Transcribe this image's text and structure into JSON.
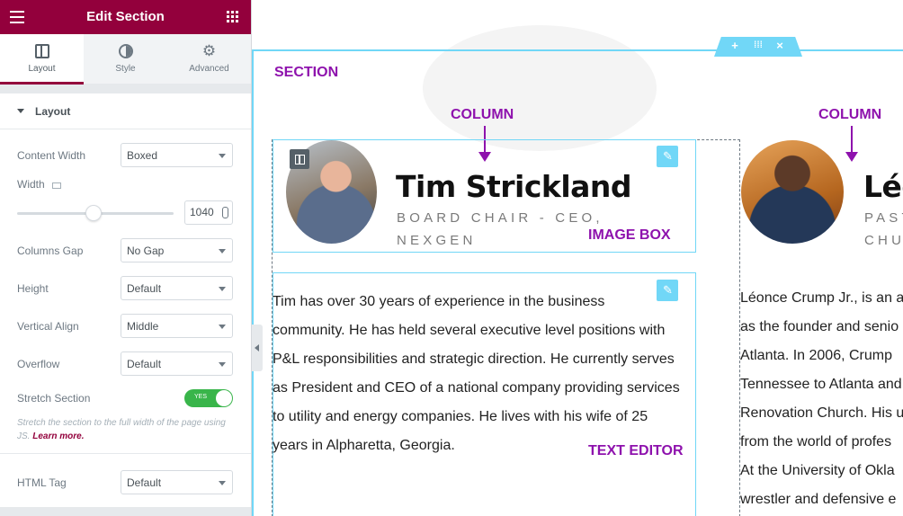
{
  "panel": {
    "title": "Edit Section",
    "tabs": [
      {
        "label": "Layout",
        "icon": "layout-icon"
      },
      {
        "label": "Style",
        "icon": "style-icon"
      },
      {
        "label": "Advanced",
        "icon": "gear-icon"
      }
    ],
    "layout_section": {
      "heading": "Layout",
      "content_width": {
        "label": "Content Width",
        "value": "Boxed"
      },
      "width": {
        "label": "Width",
        "value": "1040"
      },
      "columns_gap": {
        "label": "Columns Gap",
        "value": "No Gap"
      },
      "height": {
        "label": "Height",
        "value": "Default"
      },
      "vertical_align": {
        "label": "Vertical Align",
        "value": "Middle"
      },
      "overflow": {
        "label": "Overflow",
        "value": "Default"
      },
      "stretch_section": {
        "label": "Stretch Section",
        "toggle_text": "YES",
        "enabled": true
      },
      "help_text": "Stretch the section to the full width of the page using JS.",
      "help_link": "Learn more.",
      "html_tag": {
        "label": "HTML Tag",
        "value": "Default"
      }
    }
  },
  "annotations": {
    "section": "SECTION",
    "column_1": "COLUMN",
    "column_2": "COLUMN",
    "image_box": "IMAGE BOX",
    "text_editor": "TEXT EDITOR"
  },
  "profiles": [
    {
      "name": "Tim Strickland",
      "title_line1": "BOARD CHAIR - CEO,",
      "title_line2": "NEXGEN",
      "bio": [
        "Tim has over 30 years of experience in the business",
        "community. He has held several executive level positions with",
        "P&L responsibilities and strategic direction. He currently serves",
        "as President and CEO of a national company providing services",
        "to utility and energy companies. He lives with his wife of 25",
        "years in Alpharetta, Georgia."
      ]
    },
    {
      "name": "Léo",
      "title_line1": "PAST",
      "title_line2": "CHU",
      "bio": [
        "Léonce Crump Jr., is an a",
        "as the founder and senio",
        "Atlanta. In 2006, Crump",
        "Tennessee to Atlanta and",
        "Renovation Church. His u",
        "from the world of profes",
        "At the University of Okla",
        "wrestler and defensive e"
      ]
    }
  ],
  "colors": {
    "brand": "#93003c",
    "editor_accent": "#71d7f7",
    "annotation": "#8e12ad",
    "toggle_on": "#39b54a"
  }
}
